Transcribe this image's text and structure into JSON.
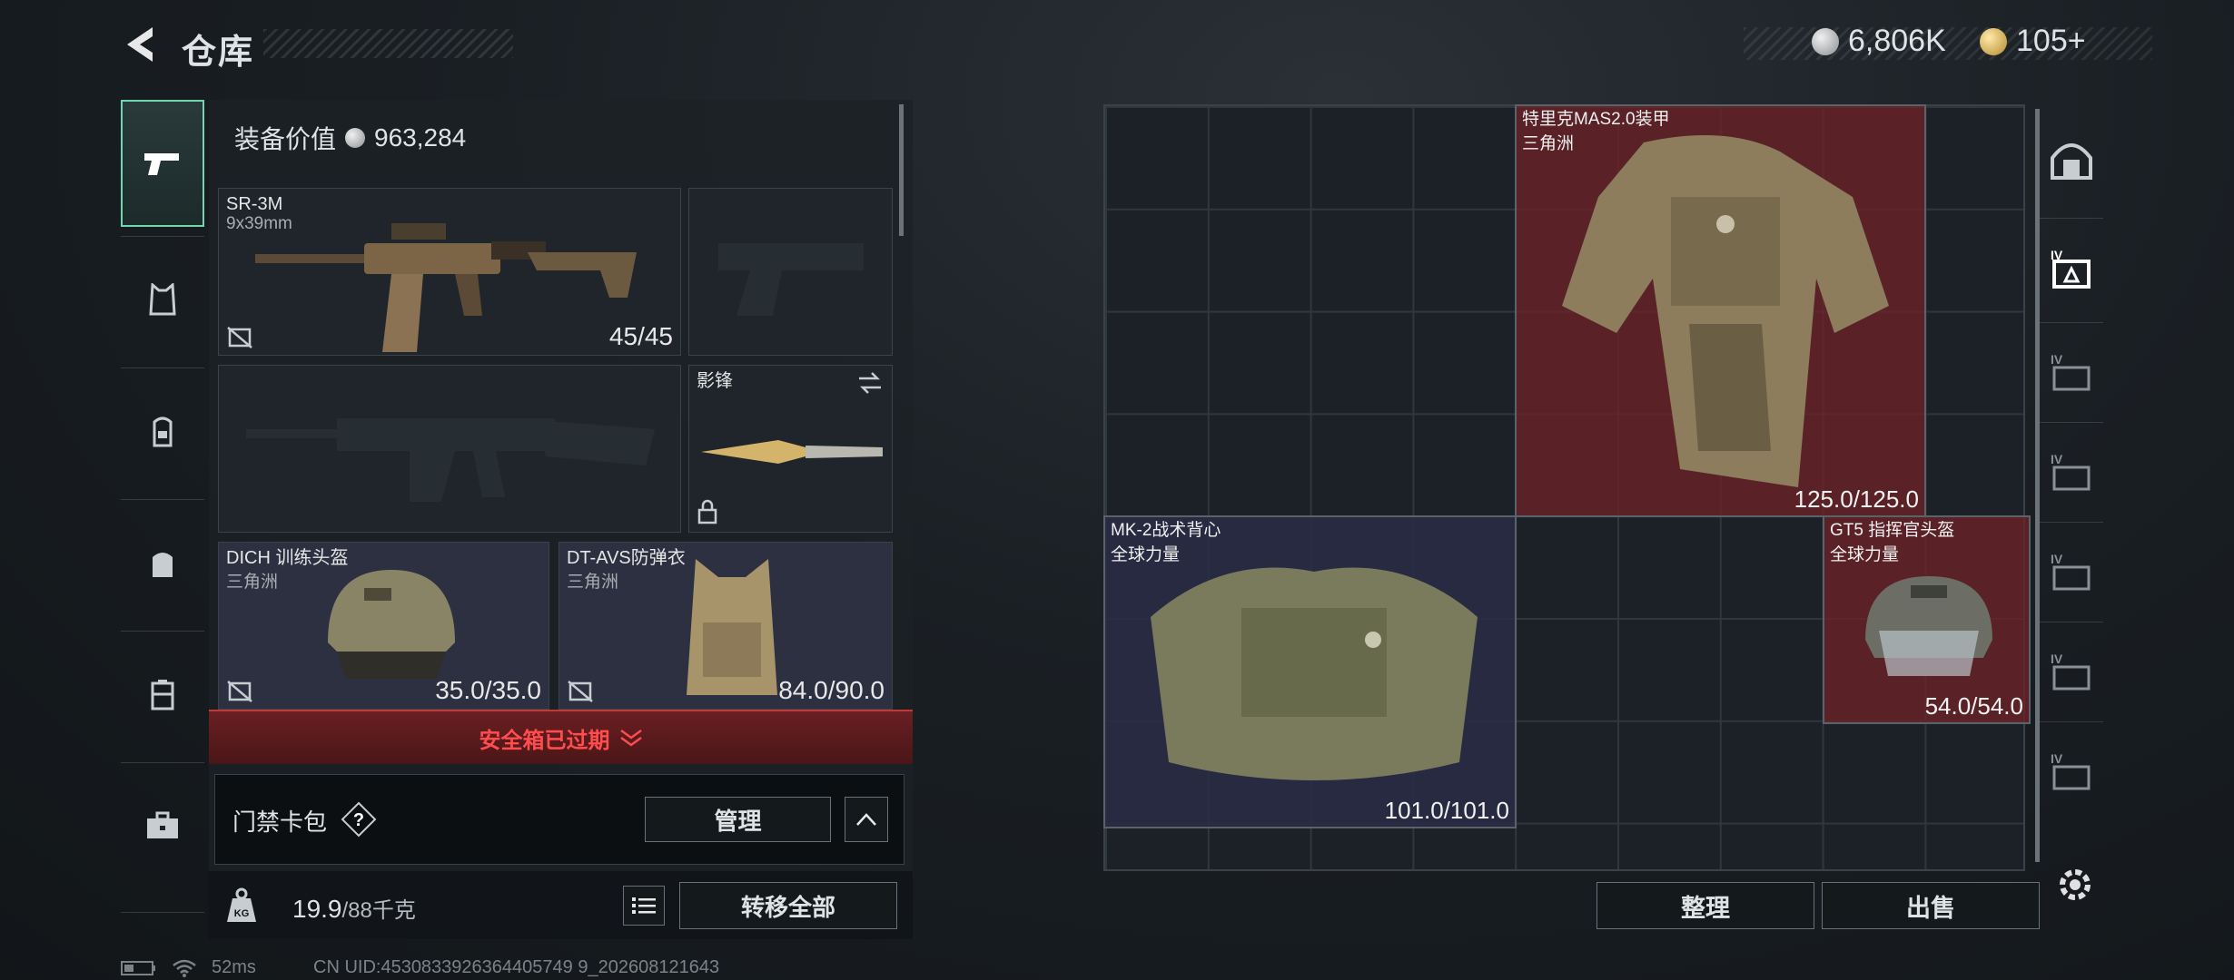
{
  "header": {
    "title": "仓库",
    "currency_silver": "6,806K",
    "currency_gold": "105+"
  },
  "left_panel": {
    "equip_value_label": "装备价值",
    "equip_value": "963,284",
    "primary_weapon": {
      "name": "SR-3M",
      "caliber": "9x39mm",
      "ammo": "45/45"
    },
    "melee": {
      "name": "影锋"
    },
    "helmet": {
      "name": "DICH 训练头盔",
      "origin": "三角洲",
      "durability": "35.0/35.0"
    },
    "armor": {
      "name": "DT-AVS防弹衣",
      "origin": "三角洲",
      "durability": "84.0/90.0"
    },
    "warning": "安全箱已过期",
    "keycard_label": "门禁卡包",
    "keycard_help": "?",
    "manage_label": "管理",
    "weight_current": "19.9",
    "weight_max": "/88千克",
    "transfer_all_label": "转移全部"
  },
  "stash": {
    "items": [
      {
        "name": "特里克MAS2.0装甲",
        "origin": "三角洲",
        "durability": "125.0/125.0"
      },
      {
        "name": "MK-2战术背心",
        "origin": "全球力量",
        "durability": "101.0/101.0"
      },
      {
        "name": "GT5 指挥官头盔",
        "origin": "全球力量",
        "durability": "54.0/54.0"
      }
    ],
    "sort_label": "整理",
    "sell_label": "出售"
  },
  "status": {
    "ping": "52ms",
    "uid": "CN UID:4530833926364405749 9_202608121643"
  },
  "colors": {
    "accent_green": "#6fd6b0",
    "warning_red": "#ff4c4c",
    "item_red": "#6c2228",
    "item_blue": "#2a2c46"
  }
}
